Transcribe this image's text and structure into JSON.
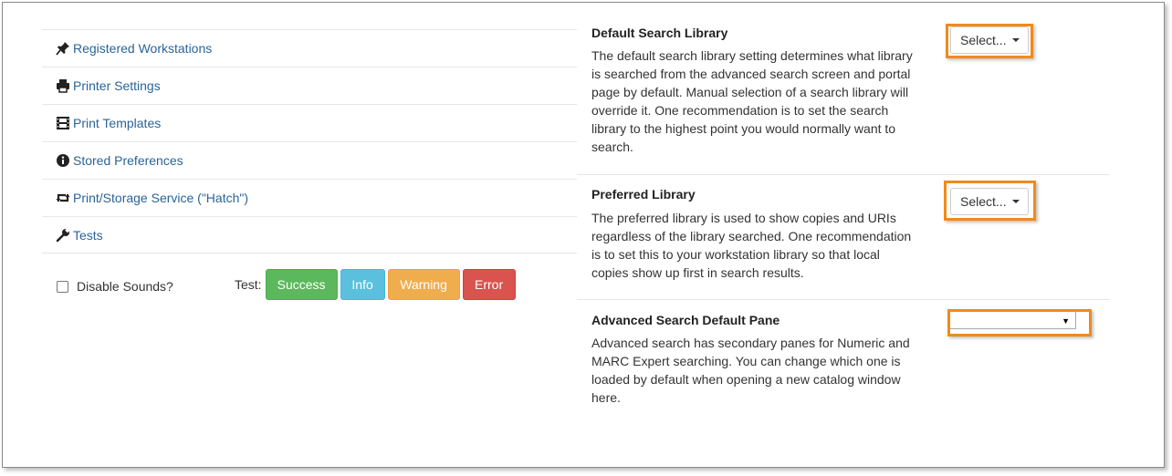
{
  "nav": {
    "items": [
      {
        "label": "Registered Workstations",
        "icon": "pushpin-icon"
      },
      {
        "label": "Printer Settings",
        "icon": "printer-icon"
      },
      {
        "label": "Print Templates",
        "icon": "film-icon"
      },
      {
        "label": "Stored Preferences",
        "icon": "info-sign-icon"
      },
      {
        "label": "Print/Storage Service (\"Hatch\")",
        "icon": "retweet-icon"
      },
      {
        "label": "Tests",
        "icon": "wrench-icon"
      }
    ]
  },
  "sounds": {
    "label": "Disable Sounds?",
    "checked": false
  },
  "test": {
    "label": "Test:",
    "buttons": [
      {
        "label": "Success",
        "color": "#5cb85c"
      },
      {
        "label": "Info",
        "color": "#5bc0de"
      },
      {
        "label": "Warning",
        "color": "#f0ad4e"
      },
      {
        "label": "Error",
        "color": "#d9534f"
      }
    ]
  },
  "settings": {
    "default_search_library": {
      "title": "Default Search Library",
      "description": "The default search library setting determines what library is searched from the advanced search screen and portal page by default. Manual selection of a search library will override it. One recommendation is to set the search library to the highest point you would normally want to search.",
      "select_label": "Select..."
    },
    "preferred_library": {
      "title": "Preferred Library",
      "description": "The preferred library is used to show copies and URIs regardless of the library searched. One recommendation is to set this to your workstation library so that local copies show up first in search results.",
      "select_label": "Select..."
    },
    "advanced_search_pane": {
      "title": "Advanced Search Default Pane",
      "description": "Advanced search has secondary panes for Numeric and MARC Expert searching. You can change which one is loaded by default when opening a new catalog window here.",
      "selected_value": ""
    }
  },
  "colors": {
    "highlight": "#f28a1b",
    "link": "#2a6496"
  }
}
